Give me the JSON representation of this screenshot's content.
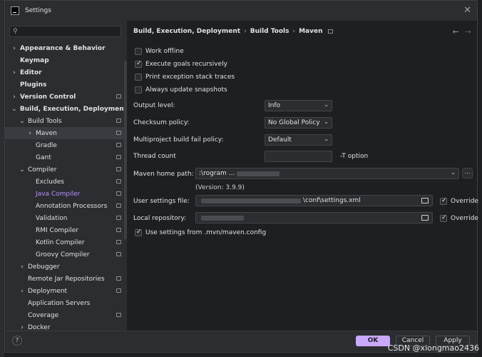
{
  "window": {
    "title": "Settings"
  },
  "sidebar": {
    "items": [
      {
        "label": "Appearance & Behavior",
        "level": 0,
        "chev": "›",
        "bold": true,
        "icon": false
      },
      {
        "label": "Keymap",
        "level": 0,
        "chev": "",
        "bold": true,
        "icon": false
      },
      {
        "label": "Editor",
        "level": 0,
        "chev": "›",
        "bold": true,
        "icon": false
      },
      {
        "label": "Plugins",
        "level": 0,
        "chev": "",
        "bold": true,
        "icon": false
      },
      {
        "label": "Version Control",
        "level": 0,
        "chev": "›",
        "bold": true,
        "icon": true
      },
      {
        "label": "Build, Execution, Deployment",
        "level": 0,
        "chev": "⌄",
        "bold": true,
        "icon": false
      },
      {
        "label": "Build Tools",
        "level": 1,
        "chev": "⌄",
        "bold": false,
        "icon": true
      },
      {
        "label": "Maven",
        "level": 2,
        "chev": "›",
        "bold": false,
        "icon": true,
        "selected": true
      },
      {
        "label": "Gradle",
        "level": 2,
        "chev": "",
        "bold": false,
        "icon": true
      },
      {
        "label": "Gant",
        "level": 2,
        "chev": "",
        "bold": false,
        "icon": true
      },
      {
        "label": "Compiler",
        "level": 1,
        "chev": "⌄",
        "bold": false,
        "icon": true
      },
      {
        "label": "Excludes",
        "level": 2,
        "chev": "",
        "bold": false,
        "icon": true
      },
      {
        "label": "Java Compiler",
        "level": 2,
        "chev": "",
        "bold": false,
        "icon": true,
        "link": true
      },
      {
        "label": "Annotation Processors",
        "level": 2,
        "chev": "",
        "bold": false,
        "icon": true
      },
      {
        "label": "Validation",
        "level": 2,
        "chev": "",
        "bold": false,
        "icon": true
      },
      {
        "label": "RMI Compiler",
        "level": 2,
        "chev": "",
        "bold": false,
        "icon": true
      },
      {
        "label": "Kotlin Compiler",
        "level": 2,
        "chev": "",
        "bold": false,
        "icon": true
      },
      {
        "label": "Groovy Compiler",
        "level": 2,
        "chev": "",
        "bold": false,
        "icon": true
      },
      {
        "label": "Debugger",
        "level": 1,
        "chev": "›",
        "bold": false,
        "icon": false
      },
      {
        "label": "Remote Jar Repositories",
        "level": 1,
        "chev": "",
        "bold": false,
        "icon": true
      },
      {
        "label": "Deployment",
        "level": 1,
        "chev": "›",
        "bold": false,
        "icon": true
      },
      {
        "label": "Application Servers",
        "level": 1,
        "chev": "",
        "bold": false,
        "icon": false
      },
      {
        "label": "Coverage",
        "level": 1,
        "chev": "",
        "bold": false,
        "icon": true
      },
      {
        "label": "Docker",
        "level": 1,
        "chev": "›",
        "bold": false,
        "icon": false
      }
    ]
  },
  "breadcrumb": [
    "Build, Execution, Deployment",
    "Build Tools",
    "Maven"
  ],
  "checkboxes": [
    {
      "label": "Work offline",
      "checked": false
    },
    {
      "label": "Execute goals recursively",
      "checked": true
    },
    {
      "label": "Print exception stack traces",
      "checked": false
    },
    {
      "label": "Always update snapshots",
      "checked": false
    }
  ],
  "fields": {
    "output_level": {
      "label": "Output level:",
      "value": "Info"
    },
    "checksum_policy": {
      "label": "Checksum policy:",
      "value": "No Global Policy"
    },
    "multiproject_fail": {
      "label": "Multiproject build fail policy:",
      "value": "Default"
    },
    "thread_count": {
      "label": "Thread count",
      "value": "",
      "suffix": "-T option"
    },
    "maven_home": {
      "label": "Maven home path:",
      "value": ":\\rogram ..."
    },
    "version": "(Version: 3.9.9)",
    "user_settings": {
      "label": "User settings file:",
      "value_suffix": "\\conf\\settings.xml",
      "override": "Override"
    },
    "local_repo": {
      "label": "Local repository:",
      "override": "Override"
    },
    "mvn_config": {
      "label": "Use settings from .mvn/maven.config",
      "checked": true
    }
  },
  "footer": {
    "ok": "OK",
    "cancel": "Cancel",
    "apply": "Apply",
    "help": "?"
  },
  "watermark": "CSDN @xiongmao2436"
}
